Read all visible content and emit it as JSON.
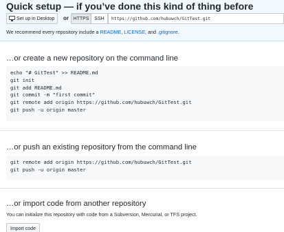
{
  "quick_setup": {
    "title": "Quick setup — if you’ve done this kind of thing before",
    "desktop_button": "Set up in Desktop",
    "or_label": "or",
    "protocols": [
      "HTTPS",
      "SSH"
    ],
    "selected_protocol": "HTTPS",
    "clone_url": "https://github.com/hubuwch/GitTest.git",
    "recommend_prefix": "We recommend every repository include a ",
    "readme_link": "README",
    "sep1": ", ",
    "license_link": "LICENSE",
    "sep2": ", and ",
    "gitignore_link": ".gitignore",
    "suffix": "."
  },
  "create_section": {
    "title": "…or create a new repository on the command line",
    "lines": [
      "echo \"# GitTest\" >> README.md",
      "git init",
      "git add README.md",
      "git commit -m \"first commit\"",
      "git remote add origin https://github.com/hubuwch/GitTest.git",
      "git push -u origin master"
    ]
  },
  "push_section": {
    "title": "…or push an existing repository from the command line",
    "lines": [
      "git remote add origin https://github.com/hubuwch/GitTest.git",
      "git push -u origin master"
    ]
  },
  "import_section": {
    "title": "…or import code from another repository",
    "description": "You can initialize this repository with code from a Subversion, Mercurial, or TFS project.",
    "button": "Import code"
  },
  "icons": {
    "desktop": "desktop-icon"
  },
  "colors": {
    "quick_setup_bg": "#f1f8ff",
    "link": "#0366d6",
    "code_bg": "#f6f8fa"
  }
}
